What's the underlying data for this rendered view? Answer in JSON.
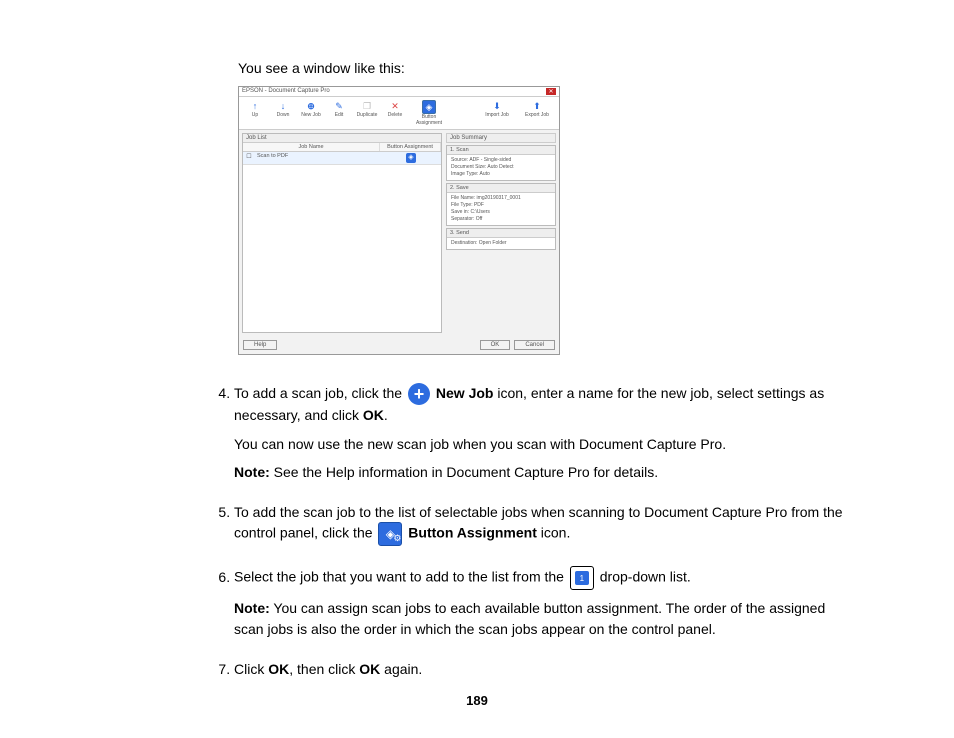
{
  "intro": "You see a window like this:",
  "window": {
    "title": "EPSON - Document Capture Pro",
    "toolbar": {
      "up": "Up",
      "down": "Down",
      "newjob": "New Job",
      "edit": "Edit",
      "duplicate": "Duplicate",
      "delete": "Delete",
      "buttonassign": "Button Assignment",
      "import": "Import Job",
      "export": "Export Job"
    },
    "joblist": {
      "title": "Job List",
      "col_name": "Job Name",
      "col_assign": "Button Assignment",
      "row1": "Scan to PDF"
    },
    "summary": {
      "title": "Job Summary",
      "scan_head": "1. Scan",
      "scan_body1": "Source: ADF - Single-sided",
      "scan_body2": "Document Size: Auto Detect",
      "scan_body3": "Image Type: Auto",
      "save_head": "2. Save",
      "save_body1": "File Name: img20190317_0001",
      "save_body2": "File Type: PDF",
      "save_body3": "Save in: C:\\Users",
      "save_body4": "Separator: Off",
      "send_head": "3. Send",
      "send_body1": "Destination: Open Folder"
    },
    "footer": {
      "help": "Help",
      "ok": "OK",
      "cancel": "Cancel"
    }
  },
  "steps": {
    "s4a": "To add a scan job, click the ",
    "s4b": " New Job",
    "s4c": " icon, enter a name for the new job, select settings as necessary, and click ",
    "s4d": "OK",
    "s4e": ".",
    "s4p2": "You can now use the new scan job when you scan with Document Capture Pro.",
    "s4note_label": "Note:",
    "s4note": " See the Help information in Document Capture Pro for details.",
    "s5a": "To add the scan job to the list of selectable jobs when scanning to Document Capture Pro from the control panel, click the ",
    "s5b": " Button Assignment",
    "s5c": " icon.",
    "s6a": "Select the job that you want to add to the list from the ",
    "s6b": " drop-down list.",
    "s6note_label": "Note:",
    "s6note": " You can assign scan jobs to each available button assignment. The order of the assigned scan jobs is also the order in which the scan jobs appear on the control panel.",
    "s7a": "Click ",
    "s7b": "OK",
    "s7c": ", then click ",
    "s7d": "OK",
    "s7e": " again."
  },
  "pagenum": "189"
}
